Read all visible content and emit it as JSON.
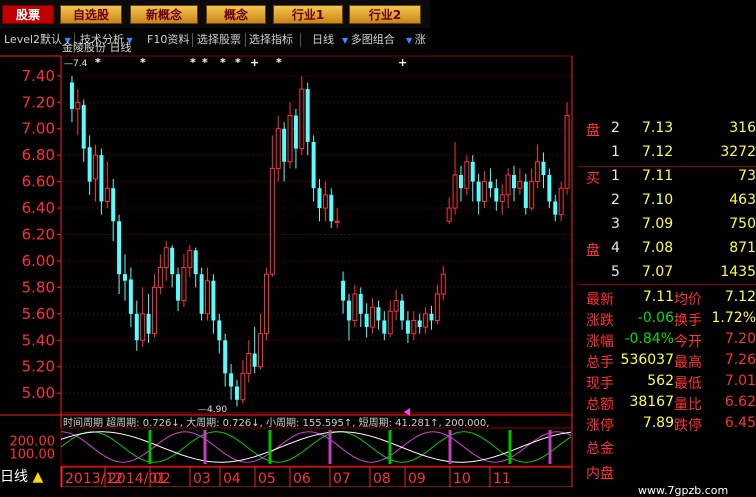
{
  "topbar": {
    "buttons": [
      {
        "label": "股票",
        "active": true
      },
      {
        "label": "自选股",
        "active": false
      },
      {
        "label": "新概念",
        "active": false
      },
      {
        "label": "概念",
        "active": false
      },
      {
        "label": "行业1",
        "active": false
      },
      {
        "label": "行业2",
        "active": false
      }
    ]
  },
  "toolbar": {
    "items": [
      "Level2默认",
      "技术分析",
      "F10资料",
      "选择股票",
      "选择指标",
      "日线",
      "多图组合",
      "涨"
    ]
  },
  "chart_data": {
    "type": "candlestick",
    "title": "金陵股份 日线",
    "ylim": [
      4.85,
      7.55
    ],
    "y_ticks": [
      "7.40",
      "7.20",
      "7.00",
      "6.80",
      "6.60",
      "6.40",
      "6.20",
      "6.00",
      "5.80",
      "5.60",
      "5.40",
      "5.20",
      "5.00"
    ],
    "x_labels": [
      "2013/12",
      "2014/01",
      "02",
      "03",
      "04",
      "05",
      "06",
      "07",
      "08",
      "09",
      "10",
      "11"
    ],
    "annotations": {
      "high": "7.4",
      "low": "4.90",
      "markers": [
        "*",
        "*",
        "*",
        "*",
        "*",
        "*",
        "+",
        "*",
        "+"
      ]
    },
    "candles": [
      [
        7.35,
        7.15,
        7.4,
        7.05
      ],
      [
        7.15,
        7.2,
        7.3,
        6.95
      ],
      [
        7.18,
        6.85,
        7.22,
        6.75
      ],
      [
        6.86,
        6.6,
        6.95,
        6.5
      ],
      [
        6.62,
        6.8,
        6.88,
        6.45
      ],
      [
        6.8,
        6.45,
        6.85,
        6.35
      ],
      [
        6.45,
        6.55,
        6.75,
        6.4
      ],
      [
        6.55,
        6.3,
        6.62,
        6.15
      ],
      [
        6.3,
        5.9,
        6.35,
        5.75
      ],
      [
        5.9,
        5.85,
        6.05,
        5.7
      ],
      [
        5.86,
        5.6,
        5.95,
        5.5
      ],
      [
        5.6,
        5.4,
        5.7,
        5.32
      ],
      [
        5.4,
        5.6,
        5.8,
        5.35
      ],
      [
        5.6,
        5.45,
        5.75,
        5.38
      ],
      [
        5.45,
        5.8,
        5.9,
        5.42
      ],
      [
        5.8,
        5.95,
        6.05,
        5.75
      ],
      [
        5.95,
        6.1,
        6.15,
        5.85
      ],
      [
        6.1,
        5.9,
        6.12,
        5.8
      ],
      [
        5.9,
        5.7,
        5.95,
        5.62
      ],
      [
        5.7,
        5.95,
        6.05,
        5.65
      ],
      [
        5.95,
        6.08,
        6.12,
        5.88
      ],
      [
        6.08,
        5.9,
        6.1,
        5.8
      ],
      [
        5.9,
        5.6,
        5.95,
        5.55
      ],
      [
        5.6,
        5.85,
        5.95,
        5.55
      ],
      [
        5.85,
        5.55,
        5.9,
        5.45
      ],
      [
        5.55,
        5.4,
        5.6,
        5.3
      ],
      [
        5.4,
        5.15,
        5.45,
        5.05
      ],
      [
        5.15,
        5.05,
        5.22,
        4.95
      ],
      [
        5.05,
        4.95,
        5.1,
        4.9
      ],
      [
        4.95,
        5.15,
        5.25,
        4.92
      ],
      [
        5.15,
        5.3,
        5.4,
        5.08
      ],
      [
        5.3,
        5.2,
        5.5,
        5.15
      ],
      [
        5.2,
        5.45,
        5.6,
        5.18
      ],
      [
        5.45,
        5.9,
        5.95,
        5.4
      ],
      [
        5.9,
        6.7,
        6.95,
        5.88
      ],
      [
        6.7,
        7.0,
        7.1,
        6.6
      ],
      [
        7.0,
        6.75,
        7.05,
        6.6
      ],
      [
        6.75,
        7.1,
        7.2,
        6.7
      ],
      [
        7.1,
        6.85,
        7.15,
        6.7
      ],
      [
        6.85,
        7.3,
        7.4,
        6.8
      ],
      [
        7.3,
        6.9,
        7.35,
        6.8
      ],
      [
        6.9,
        6.55,
        6.95,
        6.45
      ],
      [
        6.55,
        6.4,
        6.62,
        6.3
      ],
      [
        6.4,
        6.5,
        6.6,
        6.3
      ],
      [
        6.5,
        6.3,
        6.55,
        6.25
      ],
      [
        6.3,
        6.3,
        6.4,
        6.25
      ],
      [
        5.85,
        5.7,
        5.92,
        5.6
      ],
      [
        5.7,
        5.55,
        5.75,
        5.4
      ],
      [
        5.55,
        5.75,
        5.82,
        5.5
      ],
      [
        5.75,
        5.6,
        5.8,
        5.5
      ],
      [
        5.6,
        5.5,
        5.68,
        5.42
      ],
      [
        5.5,
        5.65,
        5.72,
        5.45
      ],
      [
        5.65,
        5.55,
        5.7,
        5.48
      ],
      [
        5.55,
        5.45,
        5.62,
        5.4
      ],
      [
        5.45,
        5.62,
        5.7,
        5.42
      ],
      [
        5.62,
        5.7,
        5.78,
        5.55
      ],
      [
        5.7,
        5.55,
        5.75,
        5.48
      ],
      [
        5.55,
        5.45,
        5.62,
        5.38
      ],
      [
        5.45,
        5.55,
        5.62,
        5.4
      ],
      [
        5.55,
        5.5,
        5.6,
        5.45
      ],
      [
        5.5,
        5.6,
        5.65,
        5.45
      ],
      [
        5.6,
        5.55,
        5.66,
        5.48
      ],
      [
        5.55,
        5.75,
        5.82,
        5.52
      ],
      [
        5.75,
        5.9,
        5.96,
        5.7
      ],
      [
        6.3,
        6.4,
        6.48,
        6.28
      ],
      [
        6.4,
        6.65,
        6.9,
        6.35
      ],
      [
        6.65,
        6.55,
        6.72,
        6.45
      ],
      [
        6.55,
        6.75,
        6.8,
        6.5
      ],
      [
        6.75,
        6.6,
        6.8,
        6.45
      ],
      [
        6.6,
        6.45,
        6.66,
        6.35
      ],
      [
        6.45,
        6.6,
        6.68,
        6.4
      ],
      [
        6.6,
        6.55,
        6.7,
        6.48
      ],
      [
        6.55,
        6.45,
        6.62,
        6.38
      ],
      [
        6.45,
        6.5,
        6.58,
        6.35
      ],
      [
        6.5,
        6.65,
        6.7,
        6.4
      ],
      [
        6.65,
        6.55,
        6.72,
        6.45
      ],
      [
        6.55,
        6.6,
        6.7,
        6.5
      ],
      [
        6.6,
        6.4,
        6.66,
        6.35
      ],
      [
        6.4,
        6.6,
        6.7,
        6.38
      ],
      [
        6.6,
        6.75,
        6.88,
        6.55
      ],
      [
        6.75,
        6.65,
        6.82,
        6.55
      ],
      [
        6.65,
        6.45,
        6.7,
        6.4
      ],
      [
        6.45,
        6.35,
        6.5,
        6.3
      ],
      [
        6.35,
        6.55,
        6.6,
        6.3
      ],
      [
        6.55,
        7.1,
        7.2,
        6.5
      ]
    ],
    "indicator": {
      "ylim": [
        0,
        300
      ],
      "y_ticks": [
        "200.00",
        "100.00"
      ],
      "label": "时间周期  超周期: 0.726↓, 大周期: 0.726↓, 小周期: 155.595↑, 短周期: 41.281↑, 200.000,"
    }
  },
  "quote": {
    "rows": [
      {
        "side": "盘",
        "lvl": "2",
        "price": "7.13",
        "vol": "316"
      },
      {
        "side": "",
        "lvl": "1",
        "price": "7.12",
        "vol": "3272"
      },
      {
        "side": "买",
        "lvl": "1",
        "price": "7.11",
        "vol": "73"
      },
      {
        "side": "",
        "lvl": "2",
        "price": "7.10",
        "vol": "463"
      },
      {
        "side": "",
        "lvl": "3",
        "price": "7.09",
        "vol": "750"
      },
      {
        "side": "盘",
        "lvl": "4",
        "price": "7.08",
        "vol": "871"
      },
      {
        "side": "",
        "lvl": "5",
        "price": "7.07",
        "vol": "1435"
      }
    ],
    "stats": [
      {
        "l1": "最新",
        "v1": "7.11",
        "l2": "均价",
        "v2": "7.12"
      },
      {
        "l1": "涨跌",
        "v1": "-0.06",
        "l2": "换手",
        "v2": "1.72%"
      },
      {
        "l1": "涨幅",
        "v1": "-0.84%",
        "l2": "今开",
        "v2": "7.20"
      },
      {
        "l1": "总手",
        "v1": "536037",
        "l2": "最高",
        "v2": "7.26"
      },
      {
        "l1": "现手",
        "v1": "562",
        "l2": "最低",
        "v2": "7.01"
      },
      {
        "l1": "总额",
        "v1": "38167",
        "l2": "量比",
        "v2": "6.62"
      },
      {
        "l1": "涨停",
        "v1": "7.89",
        "l2": "跌停",
        "v2": "6.45"
      },
      {
        "l1": "总金",
        "v1": "",
        "l2": "",
        "v2": ""
      },
      {
        "l1": "内盘",
        "v1": "",
        "l2": "",
        "v2": ""
      }
    ]
  },
  "bottom": {
    "tab": "日线"
  },
  "watermark": "www.7gpzb.com",
  "colors": {
    "up": "#ff3232",
    "down": "#54ffff",
    "grid": "#8b0000",
    "axis": "#ff2020"
  }
}
